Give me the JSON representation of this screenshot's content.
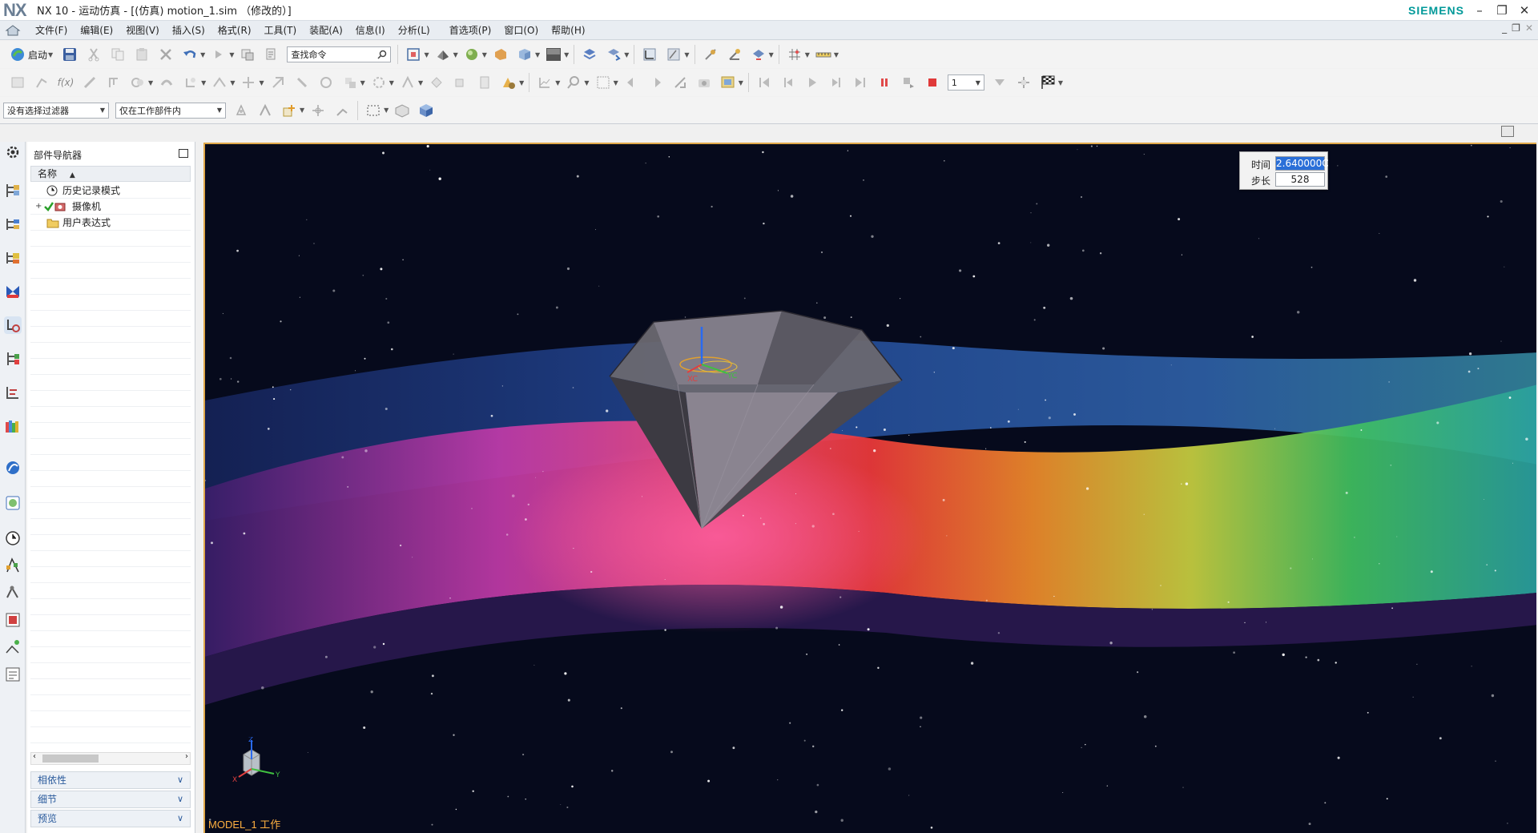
{
  "app": {
    "logo": "NX",
    "title": "NX 10 - 运动仿真 - [(仿真) motion_1.sim （修改的）]",
    "brand": "SIEMENS"
  },
  "menu": {
    "items": [
      "文件(F)",
      "编辑(E)",
      "视图(V)",
      "插入(S)",
      "格式(R)",
      "工具(T)",
      "装配(A)",
      "信息(I)",
      "分析(L)",
      "首选项(P)",
      "窗口(O)",
      "帮助(H)"
    ]
  },
  "toolbar": {
    "start_label": "启动",
    "search_placeholder": "查找命令",
    "step_combo_value": "1",
    "filter_combo_value": "没有选择过滤器",
    "scope_combo_value": "仅在工作部件内"
  },
  "navigator": {
    "title": "部件导航器",
    "column_header": "名称",
    "items": [
      {
        "label": "历史记录模式",
        "icon": "clock-icon"
      },
      {
        "label": "摄像机",
        "icon": "camera-icon"
      },
      {
        "label": "用户表达式",
        "icon": "folder-icon"
      }
    ],
    "panels": [
      "相依性",
      "细节",
      "预览"
    ]
  },
  "animation": {
    "time_label": "时间",
    "time_value": "2.640000C",
    "step_label": "步长",
    "step_value": "528"
  },
  "viewport": {
    "status": "MODEL_1 工作",
    "triad_labels": {
      "z": "Z",
      "x": "X",
      "y": "Y"
    },
    "csys_labels": {
      "x": "XC",
      "y": "YC"
    }
  },
  "colors": {
    "accent_border": "#e0a84a",
    "brand": "#009999",
    "status_text": "#ffb040",
    "selection": "#2a6fd8"
  }
}
